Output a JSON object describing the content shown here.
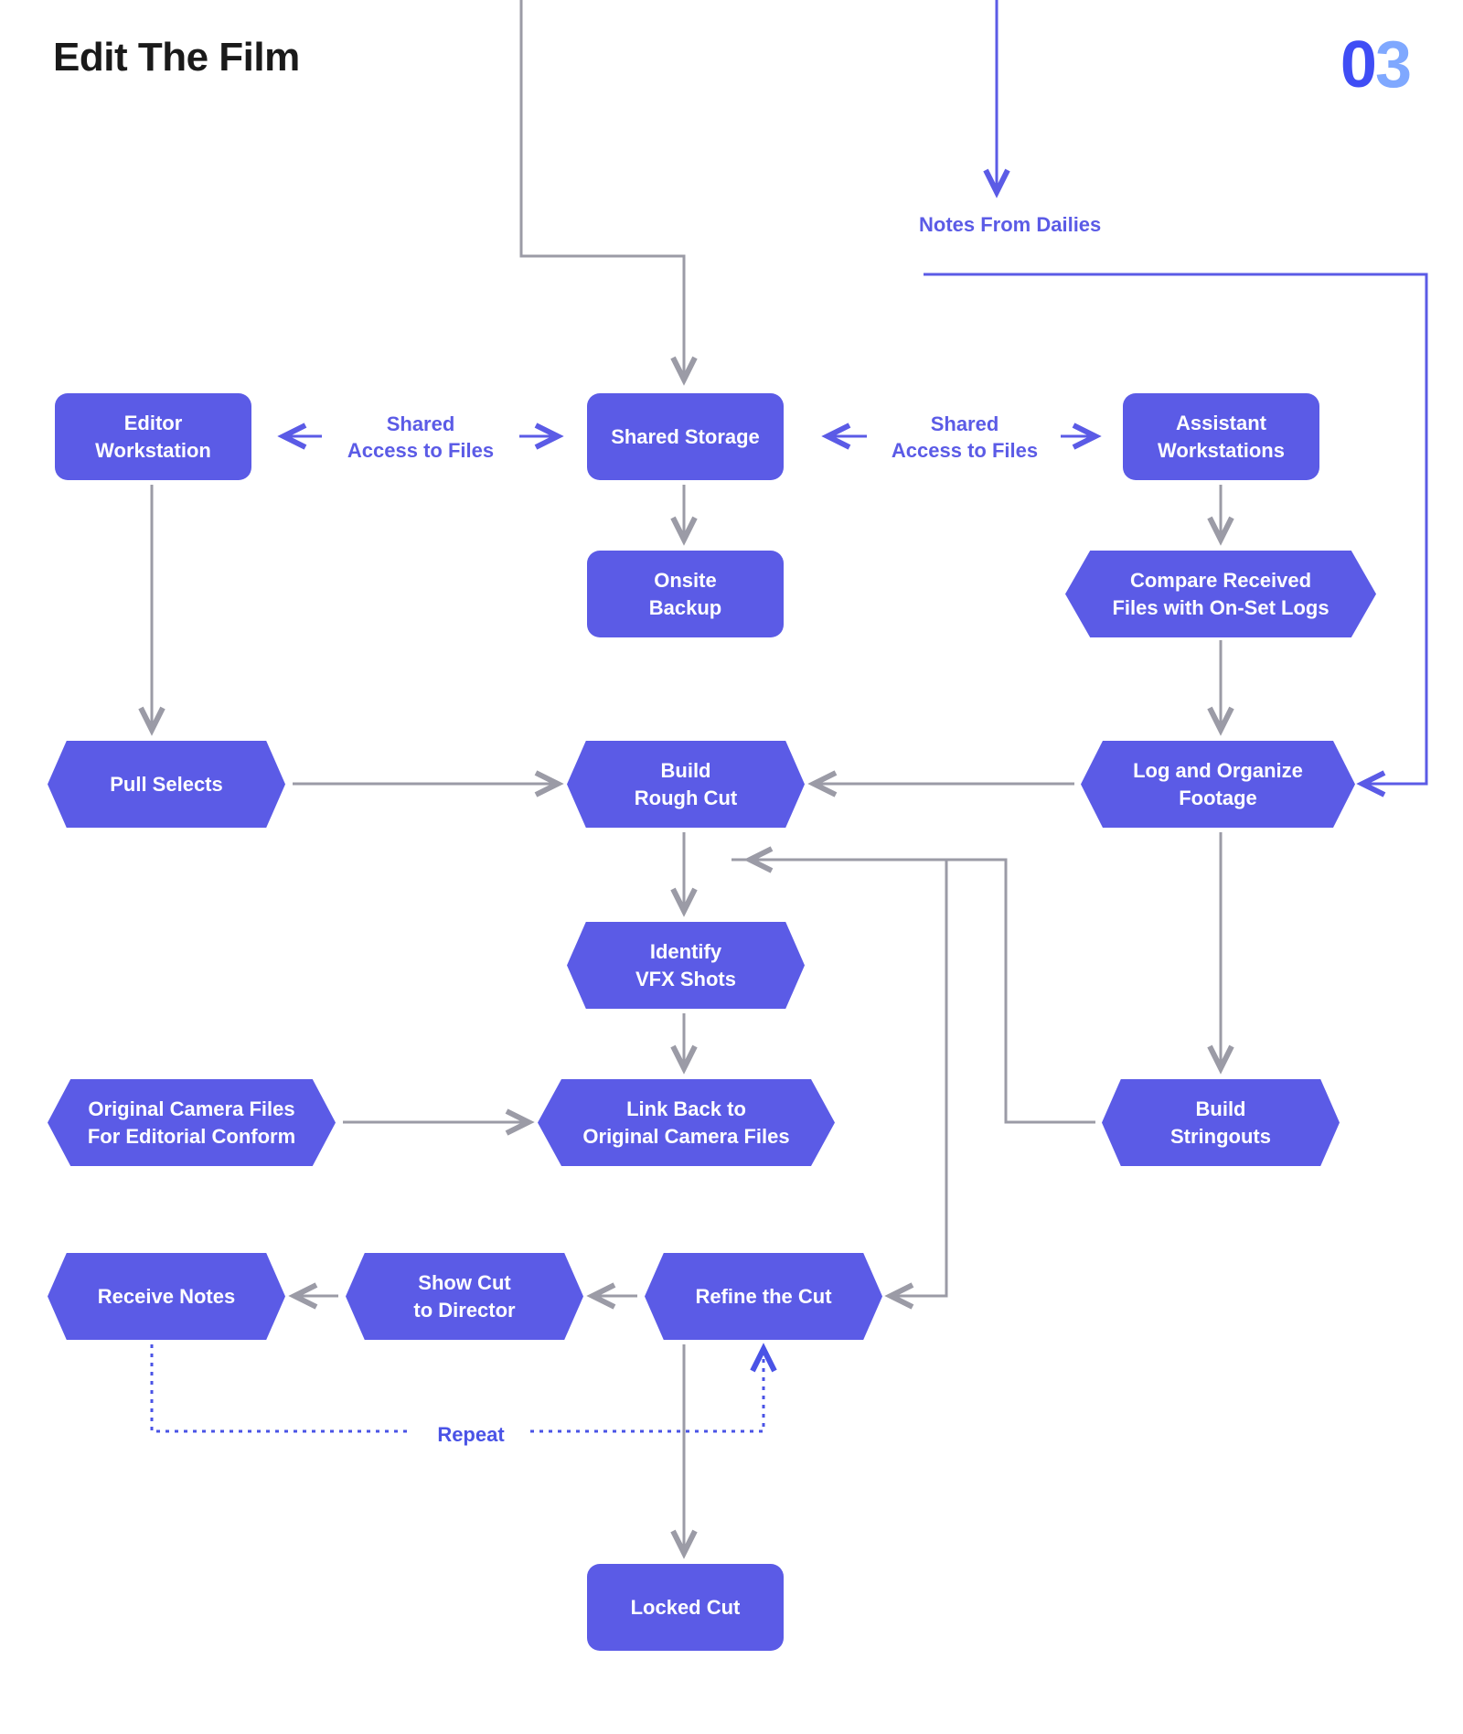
{
  "header": {
    "title": "Edit The Film",
    "stage_d1": "0",
    "stage_d2": "3"
  },
  "labels": {
    "shared_left": "Shared\nAccess to Files",
    "shared_right": "Shared\nAccess to Files",
    "notes_from_dailies": "Notes From Dailies",
    "repeat": "Repeat"
  },
  "nodes": {
    "editor_workstation": "Editor\nWorkstation",
    "shared_storage": "Shared Storage",
    "assistant_workstations": "Assistant\nWorkstations",
    "onsite_backup": "Onsite\nBackup",
    "compare_received": "Compare Received\nFiles with On-Set Logs",
    "pull_selects": "Pull Selects",
    "build_rough_cut": "Build\nRough Cut",
    "log_organize": "Log and Organize\nFootage",
    "identify_vfx": "Identify\nVFX Shots",
    "original_camera_files": "Original Camera Files\nFor Editorial Conform",
    "link_back": "Link Back to\nOriginal Camera Files",
    "build_stringouts": "Build\nStringouts",
    "receive_notes": "Receive Notes",
    "show_cut": "Show Cut\nto Director",
    "refine_cut": "Refine the Cut",
    "locked_cut": "Locked Cut"
  },
  "colors": {
    "node_fill": "#5b5be6",
    "arrow_grey": "#9b9ba6",
    "arrow_purple": "#5b5be6",
    "dotted": "#4a53e6"
  }
}
